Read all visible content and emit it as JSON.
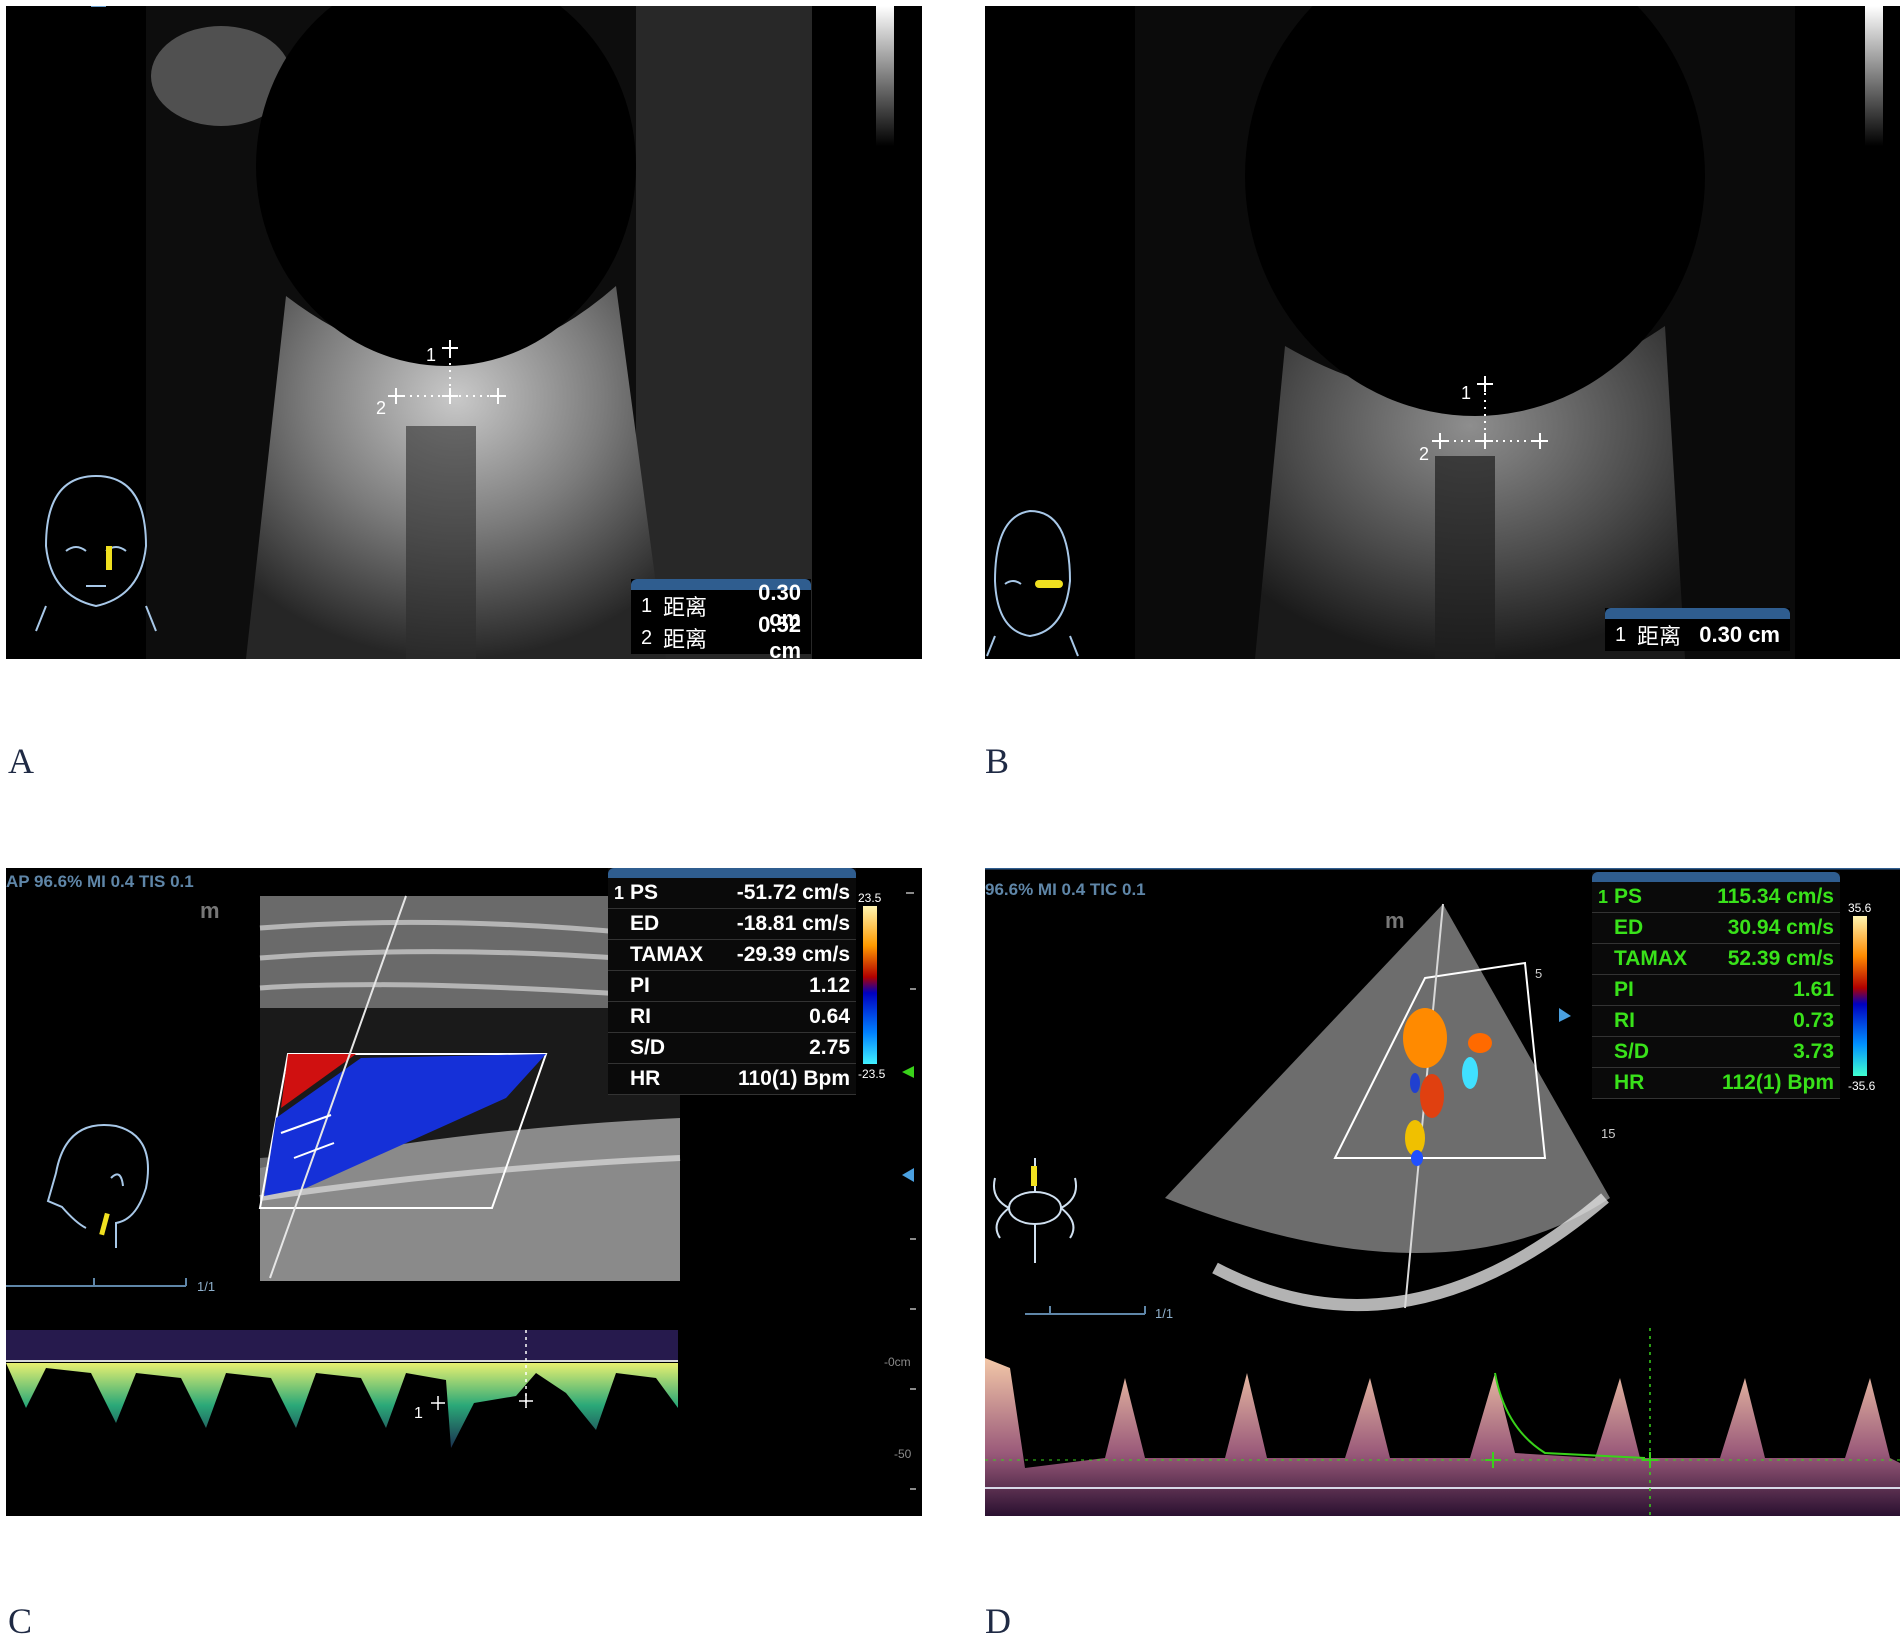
{
  "panels": {
    "A": {
      "label": "A",
      "measurements": [
        {
          "no": "1",
          "name": "距离",
          "value": "0.30 cm"
        },
        {
          "no": "2",
          "name": "距离",
          "value": "0.52 cm"
        }
      ],
      "markers": [
        "1",
        "2"
      ]
    },
    "B": {
      "label": "B",
      "measurements": [
        {
          "no": "1",
          "name": "距离",
          "value": "0.30 cm"
        }
      ],
      "markers": [
        "1",
        "2"
      ]
    },
    "C": {
      "label": "C",
      "header": "AP 96.6%  MI 0.4  TIS 0.1",
      "page": "1/1",
      "scale_top": "23.5",
      "scale_bottom": "-23.5",
      "depth_labels": [
        "-0cm",
        "-50"
      ],
      "marker": "1",
      "index_no": "1",
      "rows": [
        {
          "name": "PS",
          "value": "-51.72 cm/s"
        },
        {
          "name": "ED",
          "value": "-18.81 cm/s"
        },
        {
          "name": "TAMAX",
          "value": "-29.39 cm/s"
        },
        {
          "name": "PI",
          "value": "1.12"
        },
        {
          "name": "RI",
          "value": "0.64"
        },
        {
          "name": "S/D",
          "value": "2.75"
        },
        {
          "name": "HR",
          "value": "110(1) Bpm"
        }
      ],
      "text_color": "#ffffff"
    },
    "D": {
      "label": "D",
      "header": "96.6%  MI 0.4  TIC 0.1",
      "page": "1/1",
      "scale_top": "35.6",
      "scale_bottom": "-35.6",
      "depth_marks": [
        "5",
        "15"
      ],
      "index_no": "1",
      "rows": [
        {
          "name": "PS",
          "value": "115.34 cm/s"
        },
        {
          "name": "ED",
          "value": "30.94 cm/s"
        },
        {
          "name": "TAMAX",
          "value": "52.39 cm/s"
        },
        {
          "name": "PI",
          "value": "1.61"
        },
        {
          "name": "RI",
          "value": "0.73"
        },
        {
          "name": "S/D",
          "value": "3.73"
        },
        {
          "name": "HR",
          "value": "112(1) Bpm"
        }
      ],
      "text_color": "#39e21a"
    }
  }
}
